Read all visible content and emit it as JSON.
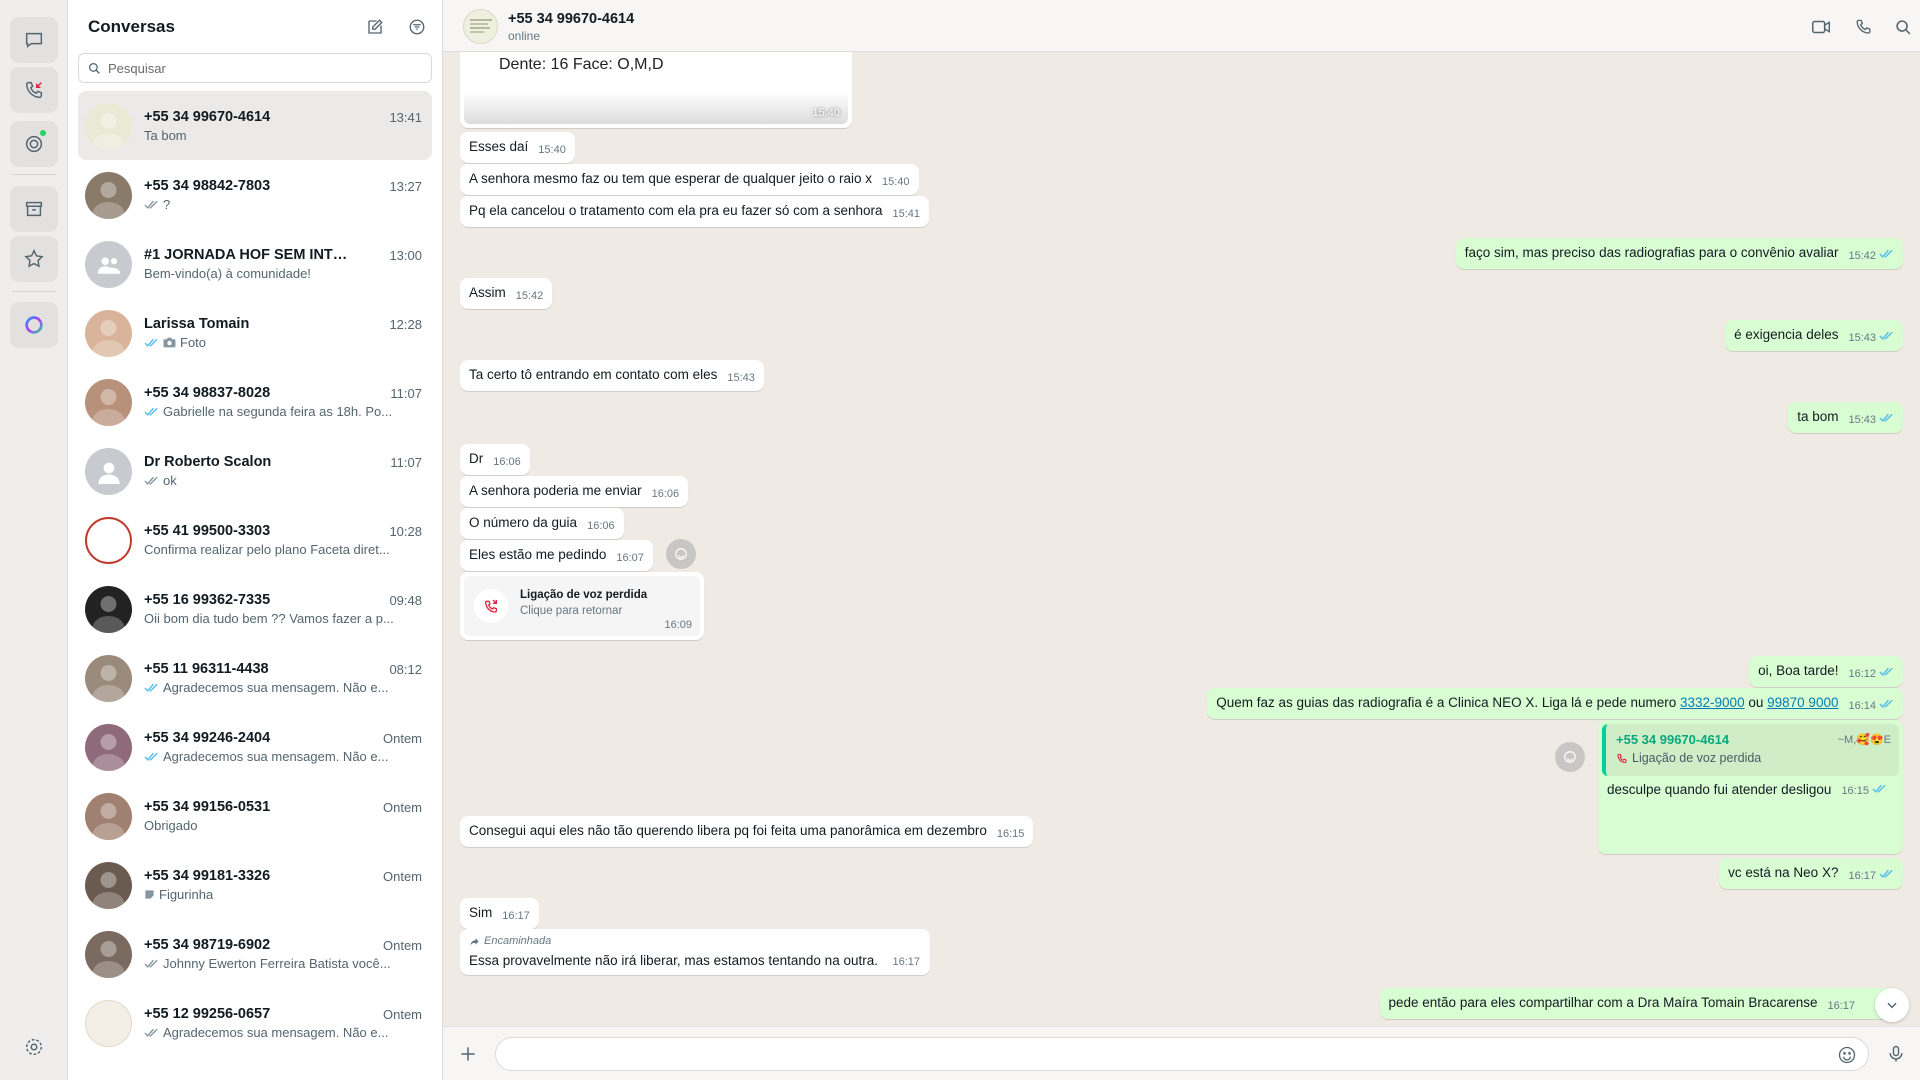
{
  "colors": {
    "accent": "#25d366",
    "outgoing_bubble": "#d9fdd3",
    "chat_bg": "#efeae3",
    "tick_blue": "#53bdeb",
    "missed_red": "#e0263f"
  },
  "rail": {
    "items": [
      {
        "icon": "chats-icon"
      },
      {
        "icon": "calls-icon"
      },
      {
        "icon": "status-icon"
      },
      {
        "icon": "archive-icon"
      },
      {
        "icon": "starred-icon"
      },
      {
        "icon": "meta-ai-icon"
      }
    ],
    "settings_icon": "settings-icon"
  },
  "sidebar": {
    "title": "Conversas",
    "search_placeholder": "Pesquisar",
    "chats": [
      {
        "name": "+55 34 99670-4614",
        "time": "13:41",
        "preview": "Ta bom",
        "ticks": "none",
        "active": true
      },
      {
        "name": "+55 34 98842-7803",
        "time": "13:27",
        "preview": "?",
        "ticks": "double-gray"
      },
      {
        "name": "#1 JORNADA HOF SEM INTERCO...",
        "time": "13:00",
        "preview": "Bem-vindo(a) à comunidade!",
        "ticks": "none"
      },
      {
        "name": "Larissa Tomain",
        "time": "12:28",
        "preview": "Foto",
        "ticks": "double-blue",
        "camera": true
      },
      {
        "name": "+55 34 98837-8028",
        "time": "11:07",
        "preview": "Gabrielle na segunda feira as 18h. Po...",
        "ticks": "double-blue"
      },
      {
        "name": "Dr Roberto Scalon",
        "time": "11:07",
        "preview": "ok",
        "ticks": "double-gray"
      },
      {
        "name": "+55 41 99500-3303",
        "time": "10:28",
        "preview": "Confirma realizar pelo plano Faceta diret...",
        "ticks": "none"
      },
      {
        "name": "+55 16 99362-7335",
        "time": "09:48",
        "preview": "Oii bom dia tudo bem ?? Vamos fazer a p...",
        "ticks": "none"
      },
      {
        "name": "+55 11 96311-4438",
        "time": "08:12",
        "preview": "Agradecemos sua mensagem. Não e...",
        "ticks": "double-blue"
      },
      {
        "name": "+55 34 99246-2404",
        "time": "Ontem",
        "preview": "Agradecemos sua mensagem. Não e...",
        "ticks": "double-blue"
      },
      {
        "name": "+55 34 99156-0531",
        "time": "Ontem",
        "preview": "Obrigado",
        "ticks": "none"
      },
      {
        "name": "+55 34 99181-3326",
        "time": "Ontem",
        "preview": "Figurinha",
        "ticks": "none",
        "sticker": true
      },
      {
        "name": "+55 34 98719-6902",
        "time": "Ontem",
        "preview": "Johnny Ewerton Ferreira Batista você...",
        "ticks": "double-gray"
      },
      {
        "name": "+55 12 99256-0657",
        "time": "Ontem",
        "preview": "Agradecemos sua mensagem. Não e...",
        "ticks": "double-gray"
      }
    ]
  },
  "header": {
    "name": "+55 34 99670-4614",
    "status": "online",
    "icons": [
      "video-call-icon",
      "voice-call-icon",
      "search-icon"
    ]
  },
  "messages": {
    "image_caption": "Dente: 16 Face: O,M,D",
    "image_time": "15:40",
    "m1": {
      "text": "Esses daí",
      "time": "15:40"
    },
    "m2": {
      "text": "A senhora mesmo faz ou tem que esperar de qualquer jeito o raio x",
      "time": "15:40"
    },
    "m3": {
      "text": "Pq ela cancelou o tratamento com ela pra eu fazer só com a senhora",
      "time": "15:41"
    },
    "m4": {
      "text": "faço sim, mas preciso das radiografias para o convênio avaliar",
      "time": "15:42"
    },
    "m5": {
      "text": "Assim",
      "time": "15:42"
    },
    "m6": {
      "text": "é exigencia deles",
      "time": "15:43"
    },
    "m7": {
      "text": "Ta certo tô entrando em contato com eles",
      "time": "15:43"
    },
    "m8": {
      "text": "ta bom",
      "time": "15:43"
    },
    "m9": {
      "text": "Dr",
      "time": "16:06"
    },
    "m10": {
      "text": "A senhora poderia me enviar",
      "time": "16:06"
    },
    "m11": {
      "text": "O número da guia",
      "time": "16:06"
    },
    "m12": {
      "text": "Eles estão me pedindo",
      "time": "16:07"
    },
    "call": {
      "title": "Ligação de voz perdida",
      "subtitle": "Clique para retornar",
      "time": "16:09"
    },
    "m13": {
      "text": "oi, Boa tarde!",
      "time": "16:12"
    },
    "m14": {
      "text": "Quem faz as guias das radiografia é a Clinica NEO X. Liga lá e pede numero",
      "link1": "3332-9000",
      "or": "ou",
      "link2": "99870 9000",
      "time": "16:14"
    },
    "quote": {
      "name": "+55 34 99670-4614",
      "subtitle": "Ligação de voz perdida",
      "tag": "~M,🥰😍E"
    },
    "m15": {
      "text": "desculpe quando fui atender desligou",
      "time": "16:15"
    },
    "m16": {
      "text": "Consegui aqui eles não tão querendo libera pq foi feita uma panorâmica em dezembro",
      "time": "16:15"
    },
    "m17": {
      "text": "vc está na Neo X?",
      "time": "16:17"
    },
    "m18": {
      "text": "Sim",
      "time": "16:17"
    },
    "forwarded": {
      "label": "Encaminhada",
      "text": "Essa provavelmente não irá liberar, mas estamos tentando na outra.",
      "time": "16:17"
    },
    "m19": {
      "text": "pede então para eles compartilhar com a Dra Maíra Tomain Bracarense",
      "time": "16:17"
    }
  },
  "composer": {
    "placeholder": ""
  }
}
